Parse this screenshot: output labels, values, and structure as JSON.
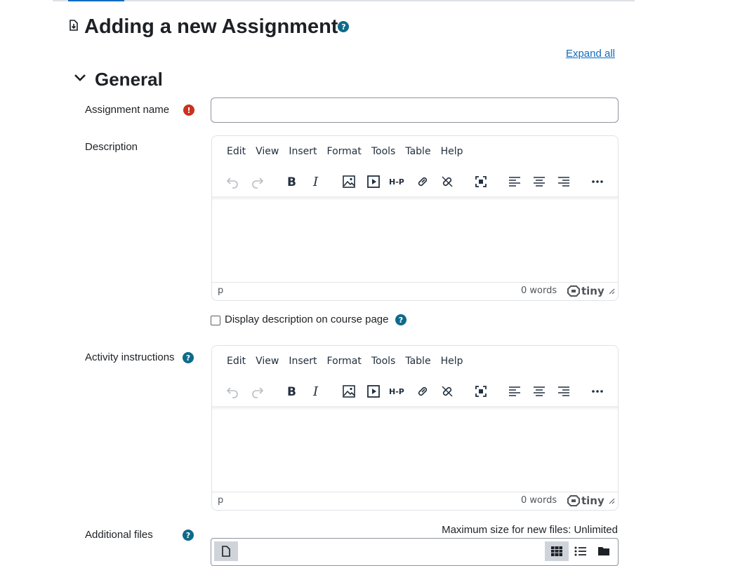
{
  "page": {
    "title": "Adding a new Assignment",
    "expand_all": "Expand all"
  },
  "section": {
    "title": "General"
  },
  "fields": {
    "assignment_name": {
      "label": "Assignment name",
      "value": "",
      "required": true
    },
    "description": {
      "label": "Description"
    },
    "display_description": {
      "label": "Display description on course page",
      "checked": false
    },
    "activity_instructions": {
      "label": "Activity instructions"
    },
    "additional_files": {
      "label": "Additional files",
      "max_size": "Maximum size for new files: Unlimited"
    }
  },
  "editor": {
    "menus": [
      "Edit",
      "View",
      "Insert",
      "Format",
      "Tools",
      "Table",
      "Help"
    ],
    "toolbar_icons": [
      "undo-icon",
      "redo-icon",
      "bold-icon",
      "italic-icon",
      "image-icon",
      "media-icon",
      "h5p-icon",
      "link-icon",
      "unlink-icon",
      "fullscreen-icon",
      "align-left-icon",
      "align-center-icon",
      "align-right-icon",
      "more-icon"
    ],
    "h5p_label": "H-P",
    "status_path": "p",
    "word_count": "0 words",
    "brand": "tiny"
  },
  "colors": {
    "accent": "#0f6cbf",
    "help": "#0f6a8a",
    "required": "#ca3120"
  }
}
